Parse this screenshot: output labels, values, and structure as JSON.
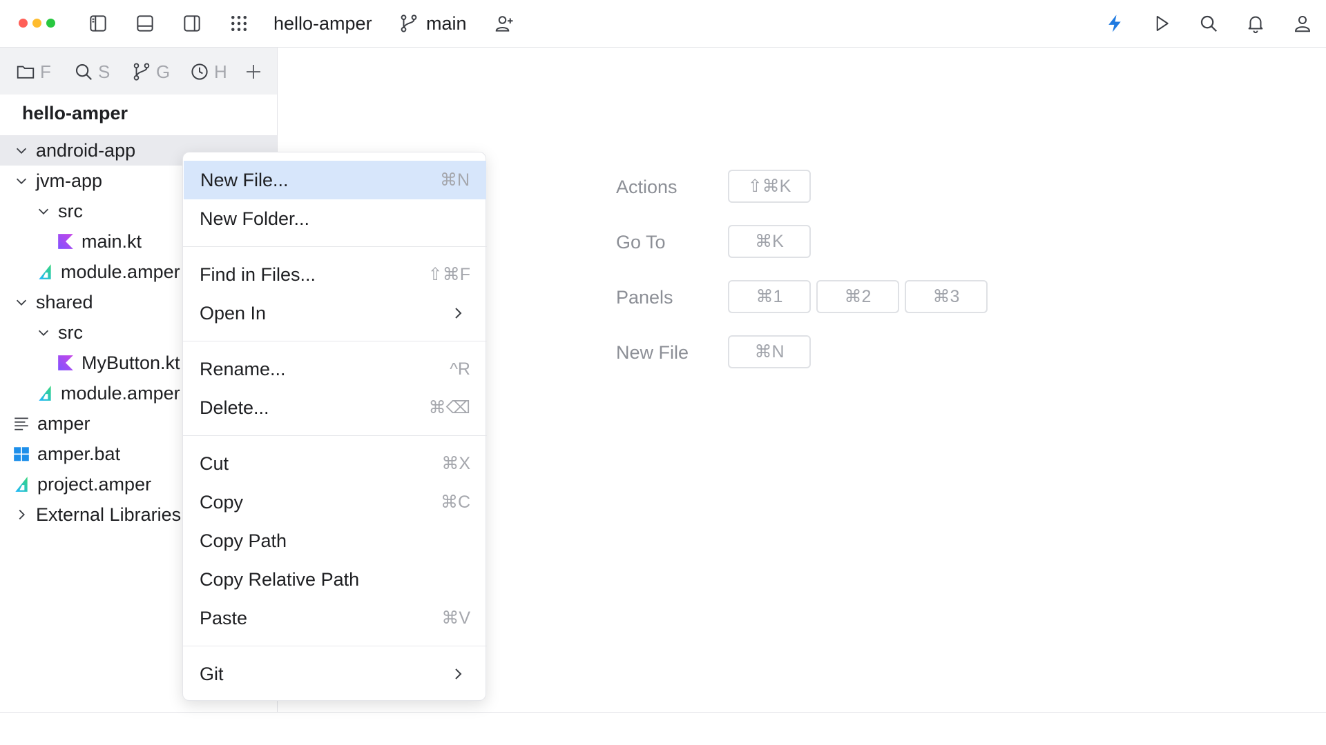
{
  "window": {
    "traffic_lights": [
      "#ff5f57",
      "#febc2e",
      "#28c840"
    ],
    "project_name": "hello-amper",
    "branch": "main",
    "accent": "#1f7ae0"
  },
  "toolbar_left_icons": [
    "left-panel-icon",
    "bottom-panel-icon",
    "right-panel-icon",
    "apps-grid-icon"
  ],
  "toolbar_right_icons": [
    "bolt-icon",
    "run-icon",
    "search-icon",
    "bell-icon",
    "user-icon"
  ],
  "sidebar": {
    "tabs": [
      {
        "icon": "folder-icon",
        "label": "F"
      },
      {
        "icon": "search-icon",
        "label": "S"
      },
      {
        "icon": "git-branch-icon",
        "label": "G"
      },
      {
        "icon": "clock-icon",
        "label": "H"
      }
    ],
    "project_title": "hello-amper",
    "tree": [
      {
        "label": "android-app",
        "icon": "chevron-down-icon",
        "selected": true
      },
      {
        "label": "jvm-app",
        "icon": "chevron-down-icon"
      },
      {
        "label": "src",
        "icon": "chevron-down-icon"
      },
      {
        "label": "main.kt",
        "icon": "kotlin-file-icon"
      },
      {
        "label": "module.amper",
        "icon": "amper-file-icon"
      },
      {
        "label": "shared",
        "icon": "chevron-down-icon"
      },
      {
        "label": "src",
        "icon": "chevron-down-icon"
      },
      {
        "label": "MyButton.kt",
        "icon": "kotlin-file-icon"
      },
      {
        "label": "module.amper",
        "icon": "amper-file-icon"
      },
      {
        "label": "amper",
        "icon": "text-file-icon"
      },
      {
        "label": "amper.bat",
        "icon": "windows-file-icon"
      },
      {
        "label": "project.amper",
        "icon": "amper-file-icon"
      },
      {
        "label": "External Libraries",
        "icon": "chevron-right-icon"
      }
    ]
  },
  "context_menu": {
    "items": [
      {
        "label": "New File...",
        "shortcut": "⌘N",
        "highlighted": true
      },
      {
        "label": "New Folder...",
        "shortcut": ""
      },
      {
        "label": "Find in Files...",
        "shortcut": "⇧⌘F"
      },
      {
        "label": "Open In",
        "submenu": true
      },
      {
        "label": "Rename...",
        "shortcut": "^R"
      },
      {
        "label": "Delete...",
        "shortcut": "⌘⌫"
      },
      {
        "label": "Cut",
        "shortcut": "⌘X"
      },
      {
        "label": "Copy",
        "shortcut": "⌘C"
      },
      {
        "label": "Copy Path",
        "shortcut": ""
      },
      {
        "label": "Copy Relative Path",
        "shortcut": ""
      },
      {
        "label": "Paste",
        "shortcut": "⌘V"
      },
      {
        "label": "Git",
        "submenu": true
      }
    ]
  },
  "editor_hints": [
    {
      "label": "Actions",
      "keys": [
        "⇧⌘K"
      ]
    },
    {
      "label": "Go To",
      "keys": [
        "⌘K"
      ]
    },
    {
      "label": "Panels",
      "keys": [
        "⌘1",
        "⌘2",
        "⌘3"
      ]
    },
    {
      "label": "New File",
      "keys": [
        "⌘N"
      ]
    }
  ]
}
